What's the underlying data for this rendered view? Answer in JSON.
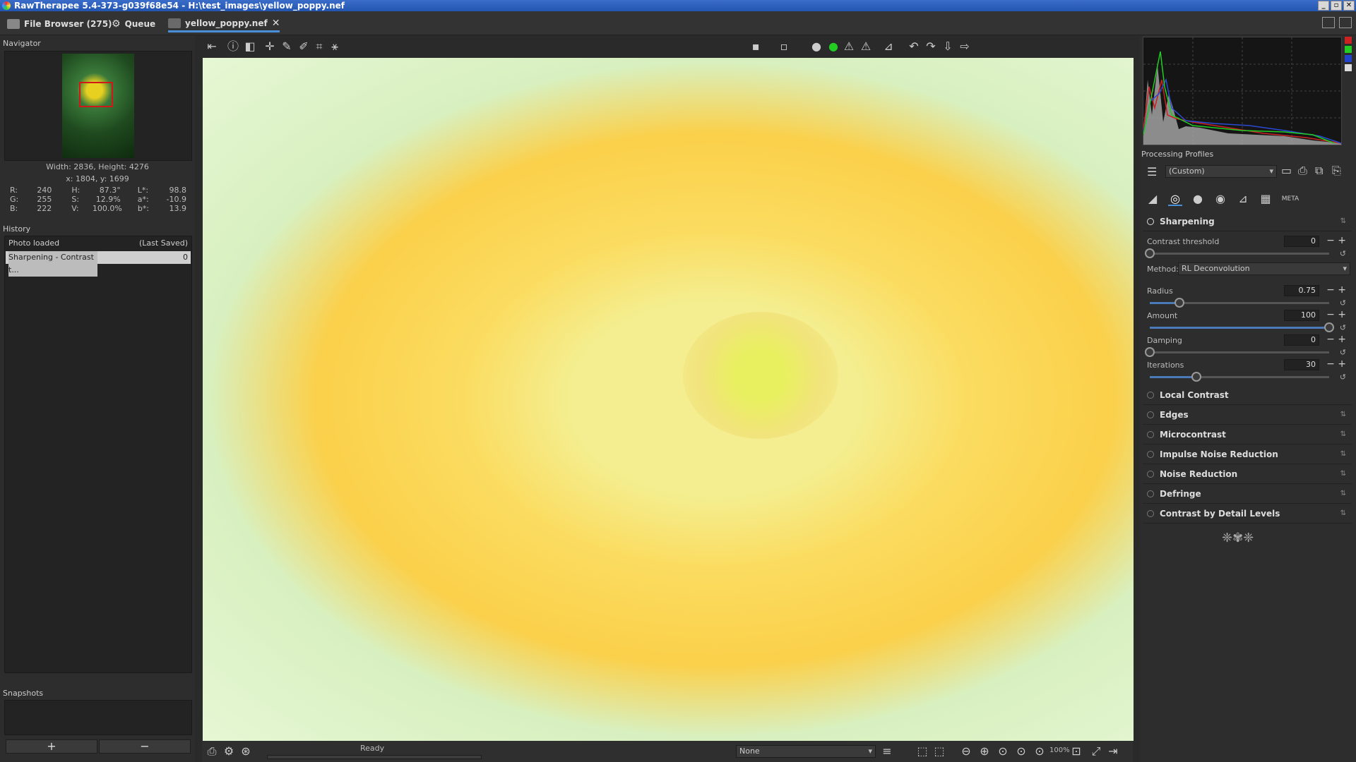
{
  "window": {
    "title": "RawTherapee 5.4-373-g039f68e54 - H:\\test_images\\yellow_poppy.nef",
    "min": "_",
    "max": "▫",
    "close": "✕"
  },
  "tabs": [
    {
      "label": "File Browser (275)"
    },
    {
      "label": "Queue"
    },
    {
      "label": "yellow_poppy.nef"
    }
  ],
  "navigator": {
    "title": "Navigator",
    "size": "Width: 2836, Height: 4276",
    "coords": "x: 1804, y: 1699",
    "rgb": [
      {
        "k": "R:",
        "v": "240"
      },
      {
        "k": "G:",
        "v": "255"
      },
      {
        "k": "B:",
        "v": "222"
      }
    ],
    "hsv": [
      {
        "k": "H:",
        "v": "87.3°"
      },
      {
        "k": "S:",
        "v": "12.9%"
      },
      {
        "k": "V:",
        "v": "100.0%"
      }
    ],
    "lab": [
      {
        "k": "L*:",
        "v": "98.8"
      },
      {
        "k": "a*:",
        "v": "-10.9"
      },
      {
        "k": "b*:",
        "v": "13.9"
      }
    ]
  },
  "history": {
    "title": "History",
    "rows": [
      {
        "label": "Photo loaded",
        "value": "(Last Saved)"
      },
      {
        "label": "Sharpening - Contrast t...",
        "value": "0"
      }
    ]
  },
  "snapshots": {
    "title": "Snapshots",
    "add": "+",
    "remove": "−"
  },
  "status": {
    "text": "Ready",
    "preset": "None",
    "zoom": "100%"
  },
  "profiles": {
    "title": "Processing Profiles",
    "selected": "(Custom)"
  },
  "sharpening": {
    "title": "Sharpening",
    "contrast_threshold": {
      "label": "Contrast threshold",
      "value": "0",
      "frac": 0.0
    },
    "method_label": "Method:",
    "method": "RL Deconvolution",
    "radius": {
      "label": "Radius",
      "value": "0.75",
      "frac": 0.165
    },
    "amount": {
      "label": "Amount",
      "value": "100",
      "frac": 1.0
    },
    "damping": {
      "label": "Damping",
      "value": "0",
      "frac": 0.0
    },
    "iterations": {
      "label": "Iterations",
      "value": "30",
      "frac": 0.26
    }
  },
  "tools": [
    {
      "label": "Local Contrast"
    },
    {
      "label": "Edges"
    },
    {
      "label": "Microcontrast"
    },
    {
      "label": "Impulse Noise Reduction"
    },
    {
      "label": "Noise Reduction"
    },
    {
      "label": "Defringe"
    },
    {
      "label": "Contrast by Detail Levels"
    }
  ],
  "meta_tab": "META"
}
